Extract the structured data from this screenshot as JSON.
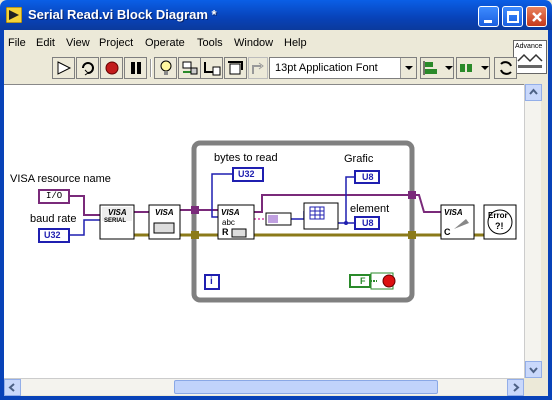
{
  "window": {
    "title": "Serial Read.vi Block Diagram *"
  },
  "menu": [
    {
      "label": "File"
    },
    {
      "label": "Edit"
    },
    {
      "label": "View"
    },
    {
      "label": "Project"
    },
    {
      "label": "Operate"
    },
    {
      "label": "Tools"
    },
    {
      "label": "Window"
    },
    {
      "label": "Help"
    }
  ],
  "palette": {
    "advanced_label": "Advance"
  },
  "toolbar": {
    "font_selector": "13pt Application Font",
    "icons": [
      "run-arrow-icon",
      "run-continuously-icon",
      "abort-icon",
      "pause-icon",
      "highlight-execution-icon",
      "retain-wire-values-icon",
      "step-into-icon",
      "step-over-icon",
      "step-out-icon",
      "align-objects-icon",
      "distribute-objects-icon",
      "reorder-icon"
    ]
  },
  "diagram": {
    "labels": {
      "visa_resource": "VISA resource name",
      "baud_rate": "baud rate",
      "bytes_to_read": "bytes to read",
      "grafic": "Grafic",
      "element": "element"
    },
    "terminals": {
      "io": "I/O",
      "u32_baud": "U32",
      "u32_bytes": "U32",
      "u8_grafic": "U8",
      "u8_element": "U8",
      "stop_const": "F"
    },
    "nodes": {
      "visa_serial_top": "VISA",
      "visa_serial_bottom": "SERIAL",
      "visa_read_top": "VISA",
      "visa_read_abc": "abc",
      "visa_read_r": "R",
      "visa_close_top": "VISA",
      "visa_close_c": "C",
      "error_top": "Error",
      "error_bottom": "?!",
      "loop_index": "i"
    },
    "colors": {
      "visa_wire": "#7a2a7a",
      "error_wire": "#8b7a1a",
      "numeric_wire": "#1f1fb0",
      "string_wire": "#e070c0",
      "loop_border": "#808080"
    }
  }
}
